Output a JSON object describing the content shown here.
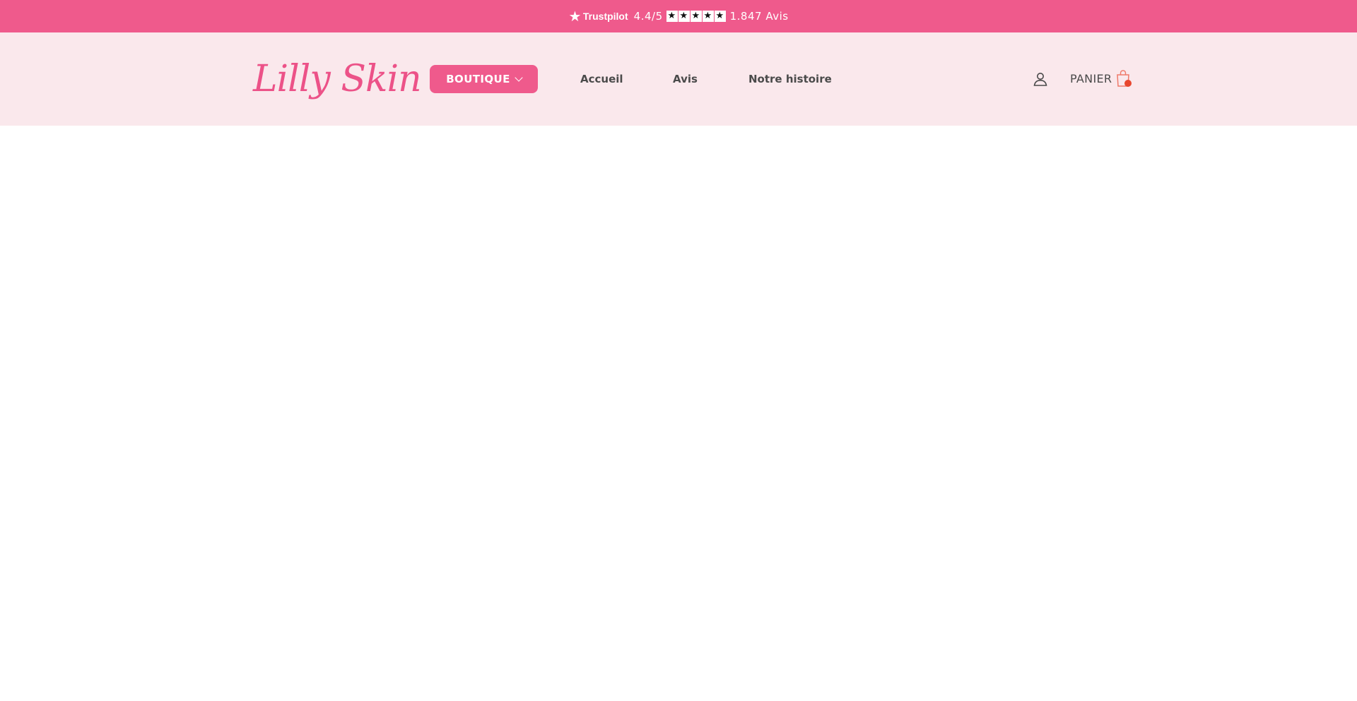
{
  "announcement": {
    "brand": "Trustpilot",
    "rating": "4.4/5",
    "stars": 5,
    "review_count": "1.847 Avis"
  },
  "header": {
    "logo_text": "Lilly Skin",
    "boutique_label": "BOUTIQUE",
    "nav": {
      "accueil": "Accueil",
      "avis": "Avis",
      "histoire": "Notre histoire"
    },
    "cart_label": "PANIER"
  },
  "colors": {
    "accent": "#ef5a8c",
    "header_bg": "#fae8ec",
    "text": "#4a4a4a",
    "cart_badge": "#e8462e"
  },
  "icons": {
    "account": "user-icon",
    "cart": "shopping-bag-icon",
    "boutique_dropdown": "chevron-down-icon",
    "trustpilot": "star-icon"
  }
}
